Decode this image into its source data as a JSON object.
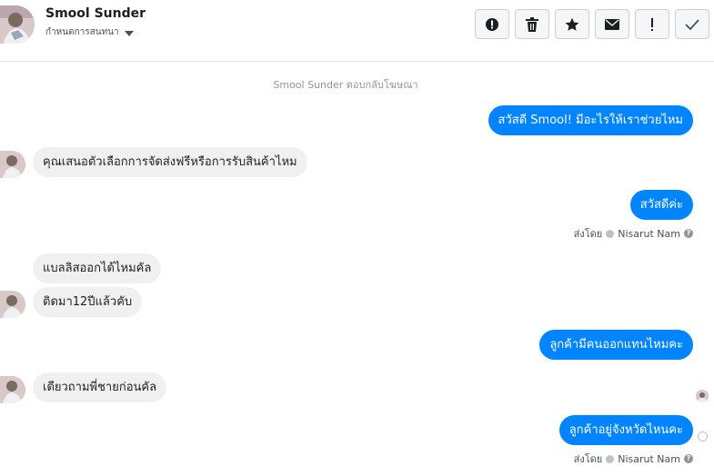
{
  "header": {
    "contact_name": "Smool Sunder",
    "stage_label": "กำหนดการสนทนา",
    "actions": [
      {
        "name": "spam-button",
        "icon": "alert-circle-icon"
      },
      {
        "name": "delete-button",
        "icon": "trash-icon"
      },
      {
        "name": "star-button",
        "icon": "star-icon"
      },
      {
        "name": "mark-unread-button",
        "icon": "envelope-icon"
      },
      {
        "name": "follow-up-button",
        "icon": "exclamation-icon"
      },
      {
        "name": "done-button",
        "icon": "check-icon"
      }
    ]
  },
  "colors": {
    "outgoing_bubble": "#0084ff",
    "incoming_bubble": "#f1f0f0",
    "muted_text": "#90949c"
  },
  "conversation": {
    "system_note": "Smool Sunder ตอบกลับโฆษณา",
    "messages": [
      {
        "direction": "out",
        "text": "สวัสดี Smool! มีอะไรให้เราช่วยไหม"
      },
      {
        "direction": "in",
        "text": "คุณเสนอตัวเลือกการจัดส่งฟรีหรือการรับสินค้าไหม"
      },
      {
        "direction": "out",
        "text": "สวัสดีค่ะ"
      },
      {
        "direction": "in",
        "text": "แบลลิสออกได้ไหมคัล"
      },
      {
        "direction": "in",
        "text": "ติดมา12ปีแล้วคับ"
      },
      {
        "direction": "out",
        "text": "ลูกค้ามีคนออกแทนไหมคะ"
      },
      {
        "direction": "in",
        "text": "เดียวถามพี่ชายก่อนคัล"
      },
      {
        "direction": "out",
        "text": "ลูกค้าอยู่จังหวัดไหนคะ"
      }
    ],
    "sent_by_label": "ส่งโดย",
    "agent_name": "Nisarut Nam"
  }
}
